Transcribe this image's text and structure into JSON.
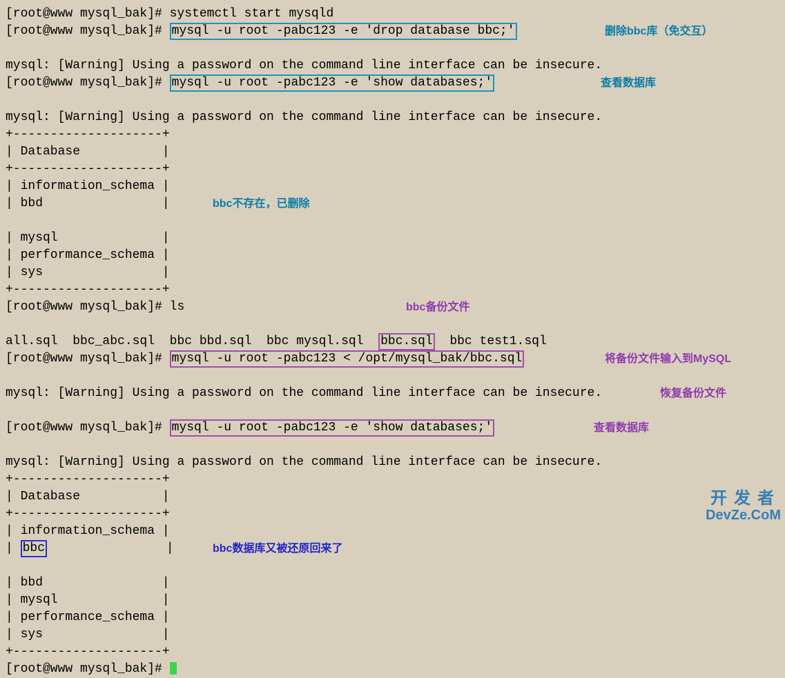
{
  "prompt": "[root@www mysql_bak]# ",
  "lines": {
    "l1_cmd": "systemctl start mysqld",
    "l2_cmd": "mysql -u root -pabc123 -e 'drop database bbc;'",
    "l3": "mysql: [Warning] Using a password on the command line interface can be insecure.",
    "l4_cmd": "mysql -u root -pabc123 -e 'show databases;'",
    "l5": "mysql: [Warning] Using a password on the command line interface can be insecure.",
    "sep": "+--------------------+",
    "hdr": "| Database           |",
    "db_is": "| information_schema |",
    "db_bbd": "| bbd                |",
    "db_mysql": "| mysql              |",
    "db_ps": "| performance_schema |",
    "db_sys": "| sys                |",
    "ls_cmd": "ls",
    "ls_out_a": "all.sql  bbc_abc.sql  bbc bbd.sql  bbc mysql.sql  ",
    "ls_out_b": "bbc.sql",
    "ls_out_c": "  bbc test1.sql",
    "rest_cmd": "mysql -u root -pabc123 < /opt/mysql_bak/bbc.sql",
    "warn2": "mysql: [Warning] Using a password on the command line interface can be insecure.",
    "show_cmd2": "mysql -u root -pabc123 -e 'show databases;'",
    "warn3": "mysql: [Warning] Using a password on the command line interface can be insecure.",
    "db_bbc": "bbc"
  },
  "annotations": {
    "a1": "删除bbc库（免交互）",
    "a2": "查看数据库",
    "a3": "bbc不存在，已删除",
    "a4": "bbc备份文件",
    "a5": "将备份文件输入到MySQL",
    "a5b": "恢复备份文件",
    "a6": "查看数据库",
    "a7": "bbc数据库又被还原回来了"
  },
  "watermark": {
    "cn": "开发者",
    "en": "DevZe.CoM"
  }
}
